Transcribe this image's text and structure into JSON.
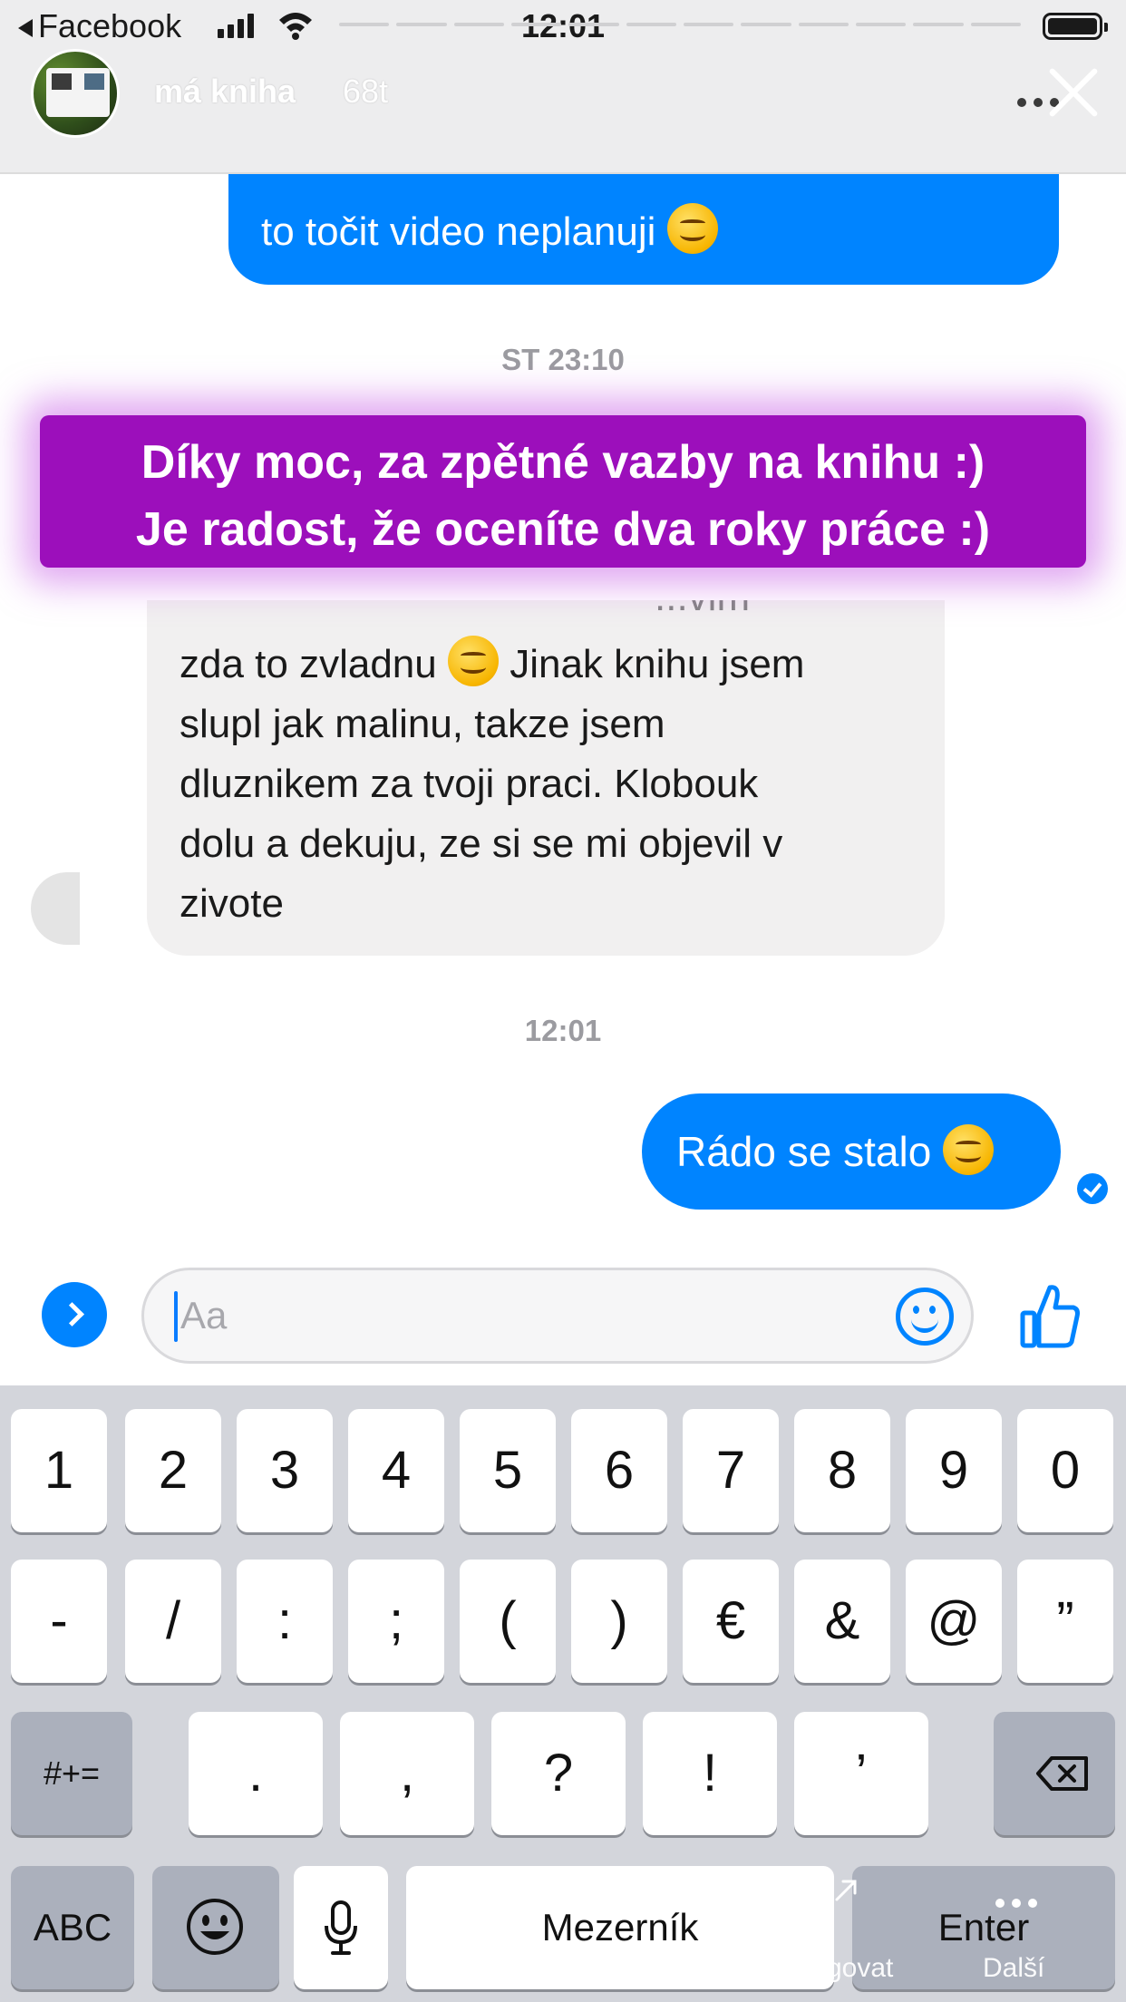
{
  "status_bar": {
    "back_label": "Facebook",
    "time": "12:01"
  },
  "story": {
    "username": "má kniha",
    "age": "68t",
    "overlay_line1": "Díky moc, za zpětné vazby na knihu :)",
    "overlay_line2": "Je radost, že oceníte dva roky práce :)"
  },
  "chat": {
    "out_top_text": "to točit video neplanuji",
    "timestamp1": "ST 23:10",
    "in_peek_text": "...vim",
    "in_lines": [
      "zda to zvladnu",
      " Jinak knihu jsem",
      "slupl jak malinu, takze jsem",
      "dluznikem za tvoji praci. Klobouk",
      "dolu a dekuju, ze si se mi objevil v",
      "zivote"
    ],
    "timestamp2": "12:01",
    "out_bottom_text": "Rádo se stalo"
  },
  "composer": {
    "placeholder": "Aa"
  },
  "keyboard": {
    "numbers": [
      "1",
      "2",
      "3",
      "4",
      "5",
      "6",
      "7",
      "8",
      "9",
      "0"
    ],
    "symbols": [
      "-",
      "/",
      ":",
      ";",
      "(",
      ")",
      "€",
      "&",
      "@",
      "”"
    ],
    "more_symbols": "#+=",
    "punctuation": [
      ".",
      ",",
      "?",
      "!",
      "’"
    ],
    "abc": "ABC",
    "space": "Mezerník",
    "enter": "Enter"
  },
  "dock": {
    "left_label": "govat",
    "right_label": "Další"
  }
}
